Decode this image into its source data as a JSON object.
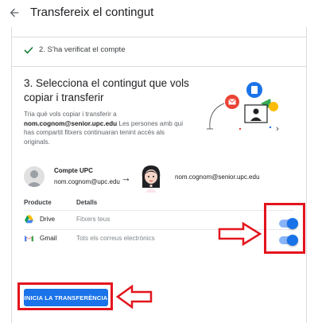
{
  "header": {
    "title": "Transfereix el contingut",
    "back_icon": "arrow-back-icon"
  },
  "steps": {
    "step2_label": "2. S'ha verificat el compte",
    "step3_title": "3. Selecciona el contingut que vols copiar i transferir",
    "description_prefix": "Tria què vols copiar i transferir a",
    "description_email": "nom.cognom@senior.upc.edu",
    "description_suffix": "Les persones amb qui has compartit fitxers continuaran tenint accés als originals."
  },
  "accounts": {
    "source_name": "Compte UPC",
    "source_email": "nom.cognom@upc.edu",
    "destination_email": "nom.cognom@senior.upc.edu"
  },
  "table": {
    "headers": [
      "Producte",
      "Detalls"
    ],
    "rows": [
      {
        "product": "Drive",
        "details": "Fitxers teus",
        "icon": "drive-icon",
        "enabled": true
      },
      {
        "product": "Gmail",
        "details": "Tots els correus electrònics",
        "icon": "gmail-icon",
        "enabled": true
      }
    ]
  },
  "actions": {
    "start_button": "INICIA LA TRANSFERÈNCIA"
  },
  "colors": {
    "primary": "#1a73e8",
    "annotation_red": "#e3141d",
    "check_green": "#188038"
  }
}
